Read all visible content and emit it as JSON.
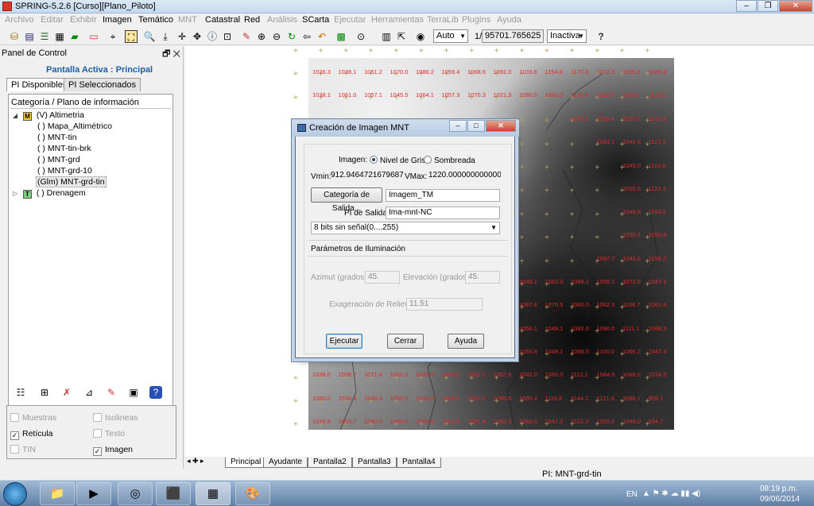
{
  "window": {
    "title": "SPRING-5.2.6 [Curso][Plano_Piloto]",
    "controls": [
      "–",
      "❐",
      "✕"
    ]
  },
  "menu": [
    {
      "label": "Archivo",
      "enabled": false
    },
    {
      "label": "Editar",
      "enabled": false
    },
    {
      "label": "Exhibir",
      "enabled": false
    },
    {
      "label": "Imagen",
      "enabled": true
    },
    {
      "label": "Temático",
      "enabled": true
    },
    {
      "label": "MNT",
      "enabled": false
    },
    {
      "label": "Catastral",
      "enabled": true
    },
    {
      "label": "Red",
      "enabled": true
    },
    {
      "label": "Análisis",
      "enabled": false
    },
    {
      "label": "SCarta",
      "enabled": true
    },
    {
      "label": "Ejecutar",
      "enabled": false
    },
    {
      "label": "Herramientas",
      "enabled": false
    },
    {
      "label": "TerraLib",
      "enabled": false
    },
    {
      "label": "Plugins",
      "enabled": false
    },
    {
      "label": "Ayuda",
      "enabled": false
    }
  ],
  "toolbar": {
    "zoom_mode": "Auto",
    "scale_prefix": "1/",
    "scale_value": "95701.765625",
    "state": "Inactiva",
    "help_glyph": "?"
  },
  "panel": {
    "header": "Panel de Control",
    "header_buttons": "🗗 ✕",
    "active_screen": "Pantalla Activa : Principal",
    "tabs": [
      "PI Disponibles",
      "PI Seleccionados"
    ],
    "tree_header": "Categoría / Plano de información",
    "tree": {
      "category1_badge": "M",
      "category1_label": "(V) Altimetria",
      "items": [
        "( ) Mapa_Altimétrico",
        "( ) MNT-tin",
        "( ) MNT-tin-brk",
        "( ) MNT-grd",
        "( ) MNT-grd-10",
        "(Glm) MNT-grd-tin"
      ],
      "category2_badge": "T",
      "category2_label": "( ) Drenagem"
    },
    "checkboxes": [
      {
        "label": "Muestras",
        "checked": false,
        "enabled": false
      },
      {
        "label": "Isolineas",
        "checked": false,
        "enabled": false
      },
      {
        "label": "Retícula",
        "checked": true,
        "enabled": true
      },
      {
        "label": "Texto",
        "checked": false,
        "enabled": false
      },
      {
        "label": "TIN",
        "checked": false,
        "enabled": false
      },
      {
        "label": "Imagen",
        "checked": true,
        "enabled": true
      }
    ]
  },
  "map": {
    "elevation_rows": [
      [
        "1026.3",
        "1038.1",
        "1051.2",
        "1070.0",
        "1086.2",
        "1059.4",
        "1068.6",
        "1091.0",
        "1103.6",
        "1154.6",
        "1170.0",
        "1212.2",
        "1185.3",
        "1069.4"
      ],
      [
        "1038.1",
        "1061.0",
        "1057.1",
        "1045.5",
        "1064.1",
        "1057.3",
        "1070.3",
        "1021.3",
        "1090.0",
        "1060.2",
        "1135.6",
        "1162.0",
        "1160.2",
        "1150.2"
      ],
      [
        "1145.5",
        "1126.4",
        "1137.5",
        "1151.6"
      ],
      [
        "1091.1",
        "1041.8",
        "1121.1"
      ],
      [
        "1045.0",
        "1110.8"
      ],
      [
        "1050.5",
        "1121.1"
      ],
      [
        "1046.8",
        "1103.2"
      ],
      [
        "1030.1",
        "1056.8"
      ],
      [
        "1097.7",
        "1043.6",
        "1038.2"
      ],
      [
        "1087.2",
        "1049.1",
        "1062.0",
        "1089.1",
        "1056.1",
        "1073.5",
        "1047.1"
      ],
      [
        "1050.0",
        "1087.6",
        "1070.5",
        "1060.0",
        "1062.3",
        "1108.7",
        "1061.4"
      ],
      [
        "1056.1",
        "1048.1",
        "1082.0",
        "1090.6",
        "1111.1",
        "1088.3"
      ],
      [
        "1055.8",
        "1049.1",
        "1058.5",
        "1100.0",
        "1066.2",
        "1047.4"
      ],
      [
        "1038.0",
        "1058.7",
        "1071.4",
        "1052.3",
        "1033.6",
        "1039.2",
        "1032.2",
        "1057.6",
        "1042.0",
        "1060.0",
        "1112.1",
        "1084.5",
        "1066.5",
        "1034.3"
      ],
      [
        "1060.0",
        "1034.4",
        "1049.3",
        "1055.0",
        "1033.2",
        "1059.5",
        "1015.5",
        "1066.5",
        "1090.4",
        "1119.8",
        "1144.1",
        "1121.9",
        "1086.1",
        "958.1"
      ],
      [
        "1026.8",
        "1053.7",
        "1060.0",
        "1059.6",
        "1050.4",
        "1061.8",
        "1061.4",
        "1062.3",
        "1060.0",
        "1047.2",
        "1122.3",
        "1150.2",
        "1049.0",
        "934.7"
      ]
    ]
  },
  "bottom_tabs": [
    "Principal",
    "Ayudante",
    "Pantalla2",
    "Pantalla3",
    "Pantalla4"
  ],
  "status": {
    "pi": "PI: MNT-grd-tin"
  },
  "tray": {
    "lang": "EN",
    "time": "08:19 p.m.",
    "date": "09/06/2014"
  },
  "dialog": {
    "title": "Creación de Imagen MNT",
    "imagen_label": "Imagen:",
    "radio_gris": "Nivel de Gris",
    "radio_sombreada": "Sombreada",
    "vmin_label": "Vmin:",
    "vmin_value": "912.9464721679687500",
    "vmax_label": "VMax:",
    "vmax_value": "1220.0000000000000000",
    "categoria_button": "Categoría de Salida...",
    "categoria_value": "Imagem_TM",
    "pi_salida_label": "PI de Salida:",
    "pi_salida_value": "Ima-mnt-NC",
    "bits_select": "8 bits sin señal(0....255)",
    "iluminacion_title": "Parámetros de Iluminación",
    "azimut_label": "Azimut (grados):",
    "azimut_value": "45.",
    "elevacion_label": "Elevación (grados):",
    "elevacion_value": "45.",
    "exageracion_label": "Exageración de Relieve:",
    "exageracion_value": "11.51",
    "btn_ejecutar": "Ejecutar",
    "btn_cerrar": "Cerrar",
    "btn_ayuda": "Ayuda"
  }
}
